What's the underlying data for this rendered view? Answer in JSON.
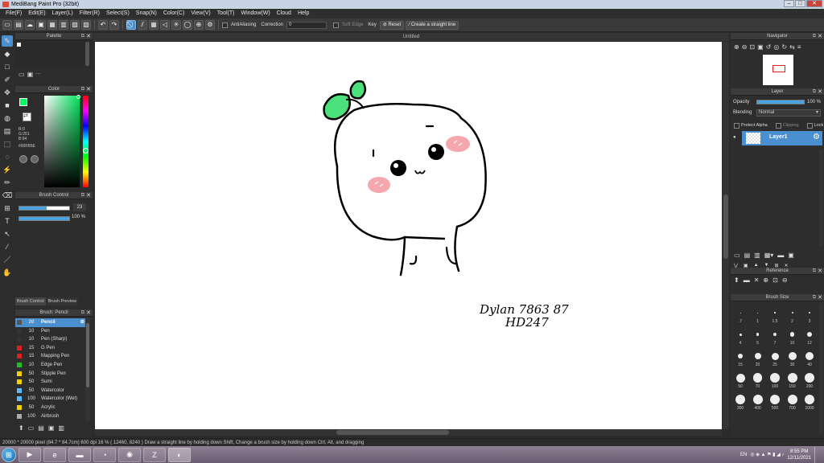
{
  "window": {
    "title": "MediBang Paint Pro (32bit)"
  },
  "menu": [
    "File(F)",
    "Edit(E)",
    "Layer(L)",
    "Filter(R)",
    "Select(S)",
    "Snap(N)",
    "Color(C)",
    "View(V)",
    "Tool(T)",
    "Window(W)",
    "Cloud",
    "Help"
  ],
  "toolbar": {
    "antialiasing": "AntiAliasing",
    "correction_label": "Correction",
    "correction_value": "0",
    "soft_edge": "Soft Edge",
    "key": "Key",
    "reset": "Reset",
    "straight_line": "Create a straight line"
  },
  "palette": {
    "title": "Palette",
    "status": "---"
  },
  "color": {
    "title": "Color",
    "r": "R:0",
    "g": "G:251",
    "b": "B:94",
    "hex": "#00FB5E",
    "fg_color": "#00fb5e"
  },
  "brush_control": {
    "title": "Brush Control",
    "size": "23",
    "opacity": "100 %",
    "size_fraction": 0.55,
    "opacity_fraction": 1.0
  },
  "brush_tabs": [
    "Brush Control",
    "Brush Preview"
  ],
  "brush_panel": {
    "title": "Brush: Pencil",
    "items": [
      {
        "size": "20",
        "name": "Pencil",
        "color": "#555555"
      },
      {
        "size": "10",
        "name": "Pen",
        "color": "#333333"
      },
      {
        "size": "10",
        "name": "Pen (Sharp)",
        "color": "#333333"
      },
      {
        "size": "15",
        "name": "G Pen",
        "color": "#e02020"
      },
      {
        "size": "15",
        "name": "Mapping Pen",
        "color": "#e02020"
      },
      {
        "size": "10",
        "name": "Edge Pen",
        "color": "#20c020"
      },
      {
        "size": "50",
        "name": "Stipple Pen",
        "color": "#f0d000"
      },
      {
        "size": "50",
        "name": "Sumi",
        "color": "#f0d000"
      },
      {
        "size": "50",
        "name": "Watercolor",
        "color": "#5bb8ff"
      },
      {
        "size": "100",
        "name": "Watercolor (Wet)",
        "color": "#5bb8ff"
      },
      {
        "size": "50",
        "name": "Acrylic",
        "color": "#f0d000"
      },
      {
        "size": "100",
        "name": "Airbrush",
        "color": "#aaaaaa"
      }
    ]
  },
  "document": {
    "tab": "Untitled",
    "signature_line1": "Dylan 7863 87",
    "signature_line2": "HD247"
  },
  "navigator": {
    "title": "Navigator"
  },
  "layer_panel": {
    "title": "Layer",
    "opacity_label": "Opacity",
    "opacity_value": "100 %",
    "blending_label": "Blending",
    "blending_value": "Normal",
    "protect_alpha": "Protect Alpha",
    "clipping": "Clipping",
    "lock": "Lock",
    "layer_name": "Layer1"
  },
  "reference": {
    "title": "Reference"
  },
  "brush_size": {
    "title": "Brush Size",
    "sizes": [
      ".7",
      "1",
      "1.5",
      "2",
      "3",
      "4",
      "5",
      "7",
      "10",
      "12",
      "15",
      "20",
      "25",
      "30",
      "40",
      "50",
      "70",
      "100",
      "150",
      "200",
      "300",
      "400",
      "500",
      "700",
      "1000"
    ]
  },
  "status": {
    "text": "20000 * 20000 pixel   (84.7 * 84.7cm)   600 dpi   16 %   ( 12460, 8240 )   Draw a straight line by holding down Shift, Change a brush size by holding down Ctrl, Alt, and dragging"
  },
  "taskbar": {
    "lang": "EN",
    "time": "8:55 PM",
    "date": "12/11/2021"
  }
}
